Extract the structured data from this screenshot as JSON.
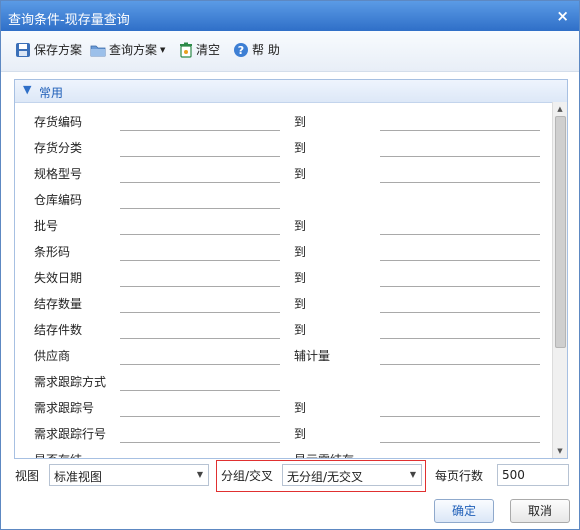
{
  "window": {
    "title": "查询条件-现存量查询",
    "close_symbol": "×"
  },
  "toolbar": {
    "save_scheme": "保存方案",
    "query_scheme": "查询方案",
    "clear": "清空",
    "help": "帮 助"
  },
  "panel": {
    "title": "常用",
    "to_label": "到",
    "rows": [
      {
        "label": "存货编码",
        "right": "到"
      },
      {
        "label": "存货分类",
        "right": "到"
      },
      {
        "label": "规格型号",
        "right": "到"
      },
      {
        "label": "仓库编码",
        "right": ""
      },
      {
        "label": "批号",
        "right": "到"
      },
      {
        "label": "条形码",
        "right": "到"
      },
      {
        "label": "失效日期",
        "right": "到"
      },
      {
        "label": "结存数量",
        "right": "到"
      },
      {
        "label": "结存件数",
        "right": "到"
      },
      {
        "label": "供应商",
        "right": "辅计量"
      },
      {
        "label": "需求跟踪方式",
        "right": ""
      },
      {
        "label": "需求跟踪号",
        "right": "到"
      },
      {
        "label": "需求跟踪行号",
        "right": "到"
      },
      {
        "label": "是否存结",
        "right": "显示零结存"
      }
    ]
  },
  "bottom": {
    "view_label": "视图",
    "view_value": "标准视图",
    "group_label": "分组/交叉",
    "group_value": "无分组/无交叉",
    "rows_per_page_label": "每页行数",
    "rows_per_page_value": "500"
  },
  "buttons": {
    "ok": "确定",
    "cancel": "取消"
  }
}
